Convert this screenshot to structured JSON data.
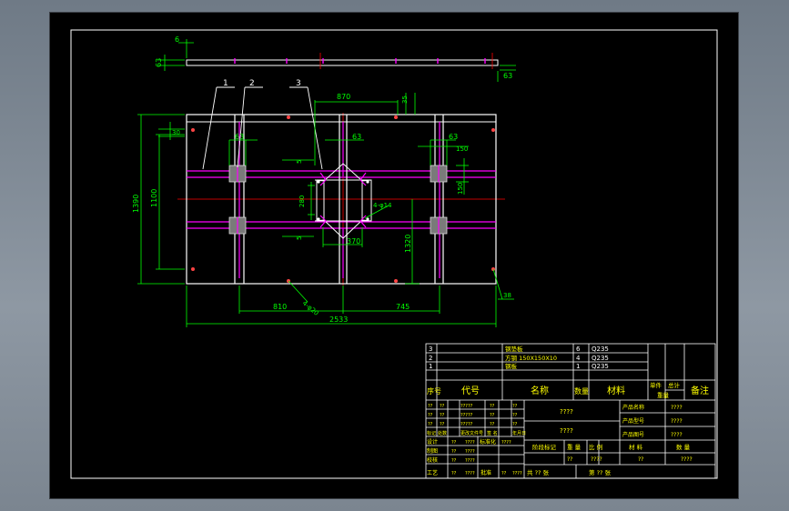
{
  "dimensions": {
    "top_bar_width": "6",
    "top_bar_height": "63",
    "top_bar_right": "63",
    "d870": "870",
    "d35": "35",
    "d30": "30",
    "d63a": "63",
    "d63b": "63",
    "d63c": "63",
    "d150h": "150",
    "d150v": "150",
    "d5a": "5",
    "d5b": "5",
    "d280": "280",
    "d4phi": "4-φ14",
    "d370": "370",
    "d1320": "1320",
    "d1390": "1390",
    "d1100": "1100",
    "d810": "810",
    "d745": "745",
    "d2533": "2533",
    "d38": "38",
    "d4phi20": "4-φ20"
  },
  "balloons": [
    "1",
    "2",
    "3"
  ],
  "bom": {
    "rows": [
      {
        "seq": "3",
        "name": "钢垫板",
        "qty": "6",
        "material": "Q235"
      },
      {
        "seq": "2",
        "name": "方钢 150X150X10",
        "qty": "4",
        "material": "Q235"
      },
      {
        "seq": "1",
        "name": "钢板",
        "qty": "1",
        "material": "Q235"
      }
    ],
    "header": {
      "seq": "序号",
      "code": "代号",
      "name": "名称",
      "qty": "数量",
      "material": "材料",
      "unit": "单件",
      "total": "总计",
      "weight": "重量",
      "remark": "备注"
    }
  },
  "title_block": {
    "q1": "????",
    "q2": "????",
    "labels": [
      "产品名称",
      "产品型号",
      "产品图号"
    ],
    "values": [
      "????",
      "????",
      "????"
    ],
    "row_marks": [
      "标记",
      "处数",
      "更改文件号",
      "签 名",
      "年月日"
    ],
    "person_labels": [
      "设计",
      "制图",
      "校核",
      "工艺"
    ],
    "person_std": "标准化",
    "person_approve": "批准",
    "stage": "阶段标记",
    "weight": "重 量",
    "scale": "比 例",
    "material": "材  料",
    "quantity": "数  量",
    "total_sheets": "共 ?? 张",
    "sheet_no": "第 ?? 张",
    "qq": "??",
    "qqqq": "????"
  },
  "colors": {
    "background": "#000000",
    "outline": "#ffffff",
    "dimension": "#00ff00",
    "center": "#ff0000",
    "hidden": "#ff00ff",
    "table_text": "#ffff00"
  }
}
